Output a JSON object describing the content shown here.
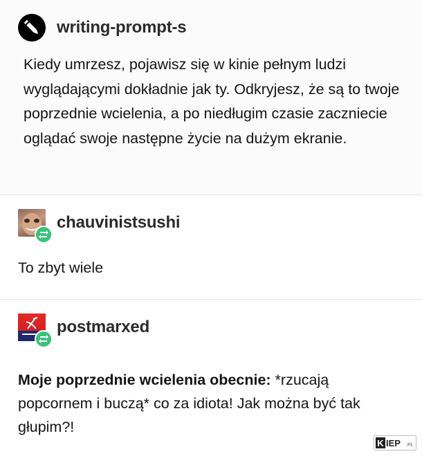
{
  "posts": [
    {
      "username": "writing-prompt-s",
      "avatar_icon": "pen-logo-icon",
      "text": "Kiedy umrzesz, pojawisz się w kinie pełnym ludzi wyglądającymi dokładnie jak ty. Odkryjesz, że są to twoje poprzednie wcielenia, a po niedługim czasie zaczniecie oglądać swoje następne życie na dużym ekranie."
    },
    {
      "username": "chauvinistsushi",
      "avatar_icon": "face-photo-avatar",
      "reblog_icon": "reblog-icon",
      "text": "To zbyt wiele"
    },
    {
      "username": "postmarxed",
      "avatar_icon": "red-flag-avatar",
      "reblog_icon": "reblog-icon",
      "text_bold": "Moje poprzednie wcielenia obecnie:",
      "text_rest": " *rzucają popcornem i buczą* co za idiota! Jak można być tak głupim?!"
    }
  ],
  "watermark": "KIEP.PL",
  "colors": {
    "reblog": "#39c27a",
    "divider": "#e4e4e4",
    "text": "#141414"
  }
}
